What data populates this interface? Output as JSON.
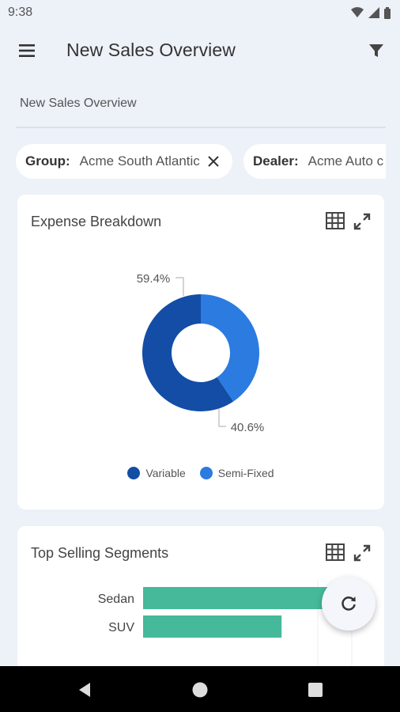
{
  "status_bar": {
    "time": "9:38",
    "icons": [
      "wifi-icon",
      "signal-icon",
      "battery-icon"
    ]
  },
  "app_bar": {
    "title": "New Sales Overview",
    "menu_icon": "hamburger-menu-icon",
    "filter_icon": "filter-icon"
  },
  "breadcrumb": "New Sales Overview",
  "filters": [
    {
      "key": "Group:",
      "value": "Acme South Atlantic"
    },
    {
      "key": "Dealer:",
      "value": "Acme Auto c"
    }
  ],
  "expense_card": {
    "title": "Expense Breakdown",
    "labels": {
      "variable_pct": "59.4%",
      "semi_fixed_pct": "40.6%"
    },
    "legend": [
      "Variable",
      "Semi-Fixed"
    ]
  },
  "segments_card": {
    "title": "Top Selling Segments"
  },
  "colors": {
    "variable": "#134da6",
    "semi_fixed": "#2b7be0",
    "bar": "#45b99a",
    "background": "#edf1f8"
  },
  "chart_data": [
    {
      "type": "pie",
      "title": "Expense Breakdown",
      "categories": [
        "Variable",
        "Semi-Fixed"
      ],
      "values": [
        59.4,
        40.6
      ],
      "legend": "bottom"
    },
    {
      "type": "bar",
      "title": "Top Selling Segments",
      "categories": [
        "Sedan",
        "SUV"
      ],
      "values": [
        100,
        73
      ]
    }
  ]
}
